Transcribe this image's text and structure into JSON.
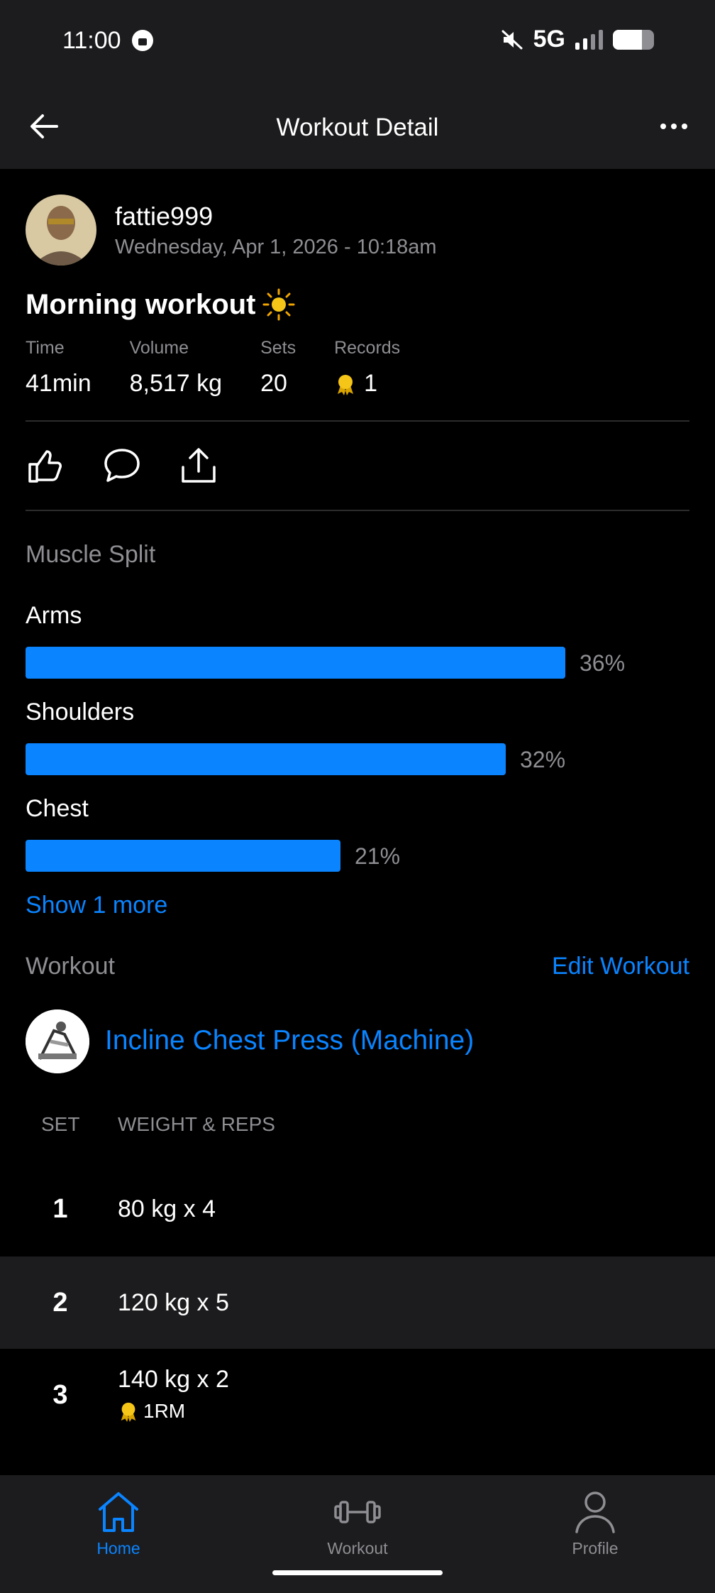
{
  "status_bar": {
    "time": "11:00",
    "network": "5G",
    "signal_bars": 4,
    "signal_active": 2,
    "battery_level": 0.7
  },
  "header": {
    "title": "Workout Detail"
  },
  "post": {
    "username": "fattie999",
    "date": "Wednesday, Apr 1, 2026 - 10:18am",
    "title": "Morning workout",
    "title_emoji": "sun"
  },
  "stats": [
    {
      "label": "Time",
      "value": "41min"
    },
    {
      "label": "Volume",
      "value": "8,517 kg"
    },
    {
      "label": "Sets",
      "value": "20"
    },
    {
      "label": "Records",
      "value": "1",
      "icon": "medal-icon"
    }
  ],
  "muscle_split": {
    "title": "Muscle Split",
    "items": [
      {
        "name": "Arms",
        "percent": 36,
        "label": "36%"
      },
      {
        "name": "Shoulders",
        "percent": 32,
        "label": "32%"
      },
      {
        "name": "Chest",
        "percent": 21,
        "label": "21%"
      }
    ],
    "show_more": "Show 1 more"
  },
  "workout": {
    "title": "Workout",
    "edit_label": "Edit Workout",
    "exercise": {
      "name": "Incline Chest Press (Machine)",
      "col_set": "SET",
      "col_weight": "WEIGHT & REPS",
      "sets": [
        {
          "num": "1",
          "value": "80 kg x 4"
        },
        {
          "num": "2",
          "value": "120 kg x 5"
        },
        {
          "num": "3",
          "value": "140 kg x 2",
          "badge": "1RM"
        }
      ]
    }
  },
  "nav": [
    {
      "label": "Home",
      "active": true
    },
    {
      "label": "Workout",
      "active": false
    },
    {
      "label": "Profile",
      "active": false
    }
  ],
  "colors": {
    "accent": "#0a84ff",
    "background": "#000000",
    "surface": "#1c1c1e",
    "muted": "#8e8e93",
    "medal": "#f5c518"
  }
}
